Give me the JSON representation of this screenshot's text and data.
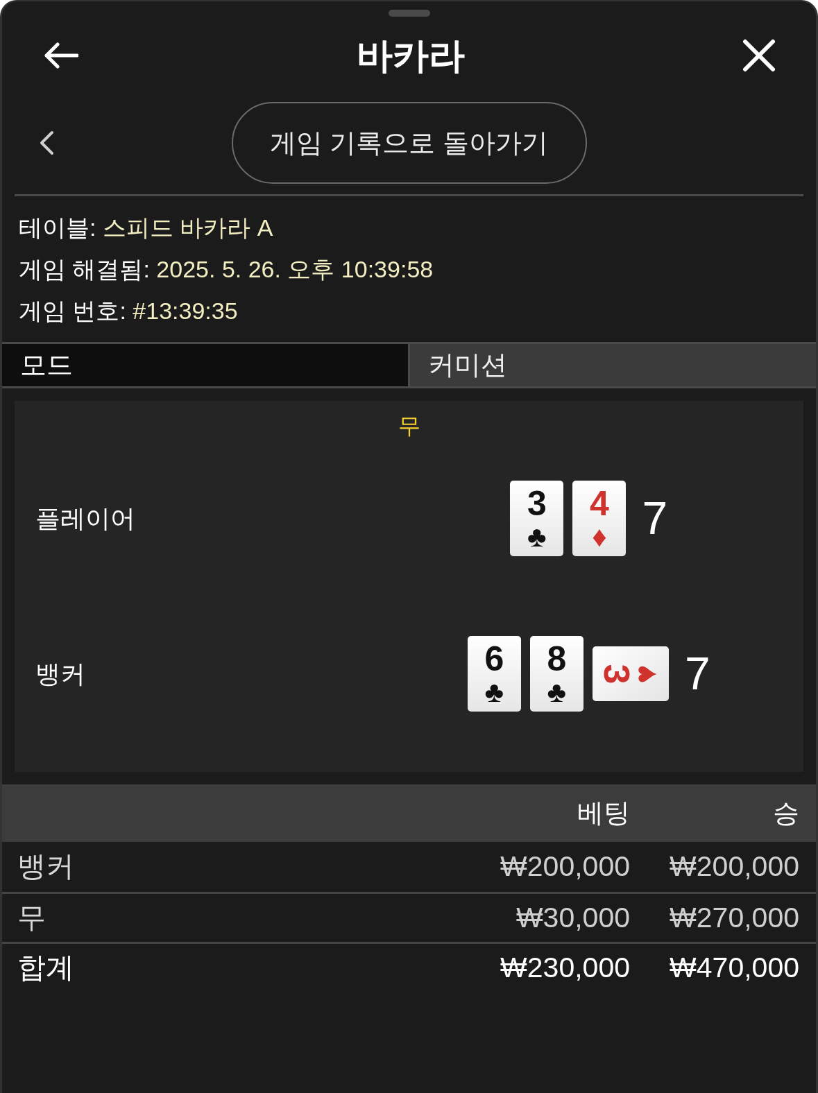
{
  "header": {
    "title": "바카라"
  },
  "back_button": {
    "label": "게임 기록으로 돌아가기"
  },
  "info": [
    {
      "label": "테이블:",
      "value": "스피드 바카라 A"
    },
    {
      "label": "게임 해결됨:",
      "value": "2025. 5. 26. 오후 10:39:58"
    },
    {
      "label": "게임 번호:",
      "value": "#13:39:35"
    }
  ],
  "tabs": [
    {
      "label": "모드",
      "selected": true
    },
    {
      "label": "커미션",
      "selected": false
    }
  ],
  "result": {
    "outcome": "무",
    "hands": [
      {
        "name": "플레이어",
        "total": "7",
        "cards": [
          {
            "rank": "3",
            "suit": "♣",
            "color": "#111111",
            "rotated": false
          },
          {
            "rank": "4",
            "suit": "♦",
            "color": "#d0322d",
            "rotated": false
          }
        ]
      },
      {
        "name": "뱅커",
        "total": "7",
        "cards": [
          {
            "rank": "6",
            "suit": "♣",
            "color": "#111111",
            "rotated": false
          },
          {
            "rank": "8",
            "suit": "♣",
            "color": "#111111",
            "rotated": false
          },
          {
            "rank": "3",
            "suit": "♥",
            "color": "#d0322d",
            "rotated": true
          }
        ]
      }
    ]
  },
  "bets_table": {
    "columns": [
      "베팅",
      "승"
    ],
    "rows": [
      {
        "name": "뱅커",
        "bet": "₩200,000",
        "win": "₩200,000",
        "total": false
      },
      {
        "name": "무",
        "bet": "₩30,000",
        "win": "₩270,000",
        "total": false
      },
      {
        "name": "합계",
        "bet": "₩230,000",
        "win": "₩470,000",
        "total": true
      }
    ]
  }
}
